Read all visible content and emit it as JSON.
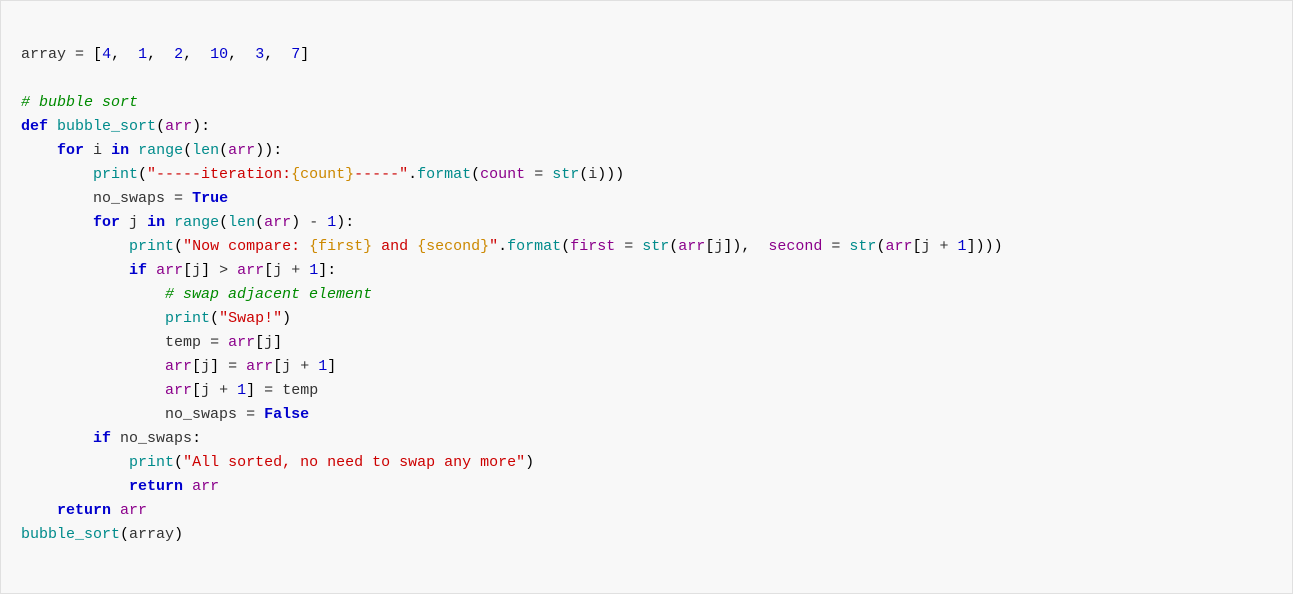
{
  "code": {
    "lines": [
      "array = [4,  1,  2,  10,  3,  7]",
      "",
      "# bubble sort",
      "def bubble_sort(arr):",
      "    for i in range(len(arr)):",
      "        print(\"-----iteration:{count}-----\".format(count = str(i)))",
      "        no_swaps = True",
      "        for j in range(len(arr) - 1):",
      "            print(\"Now compare: {first} and {second}\".format(first = str(arr[j]),  second = str(arr[j + 1])))",
      "            if arr[j] > arr[j + 1]:",
      "                # swap adjacent element",
      "                print(\"Swap!\")",
      "                temp = arr[j]",
      "                arr[j] = arr[j + 1]",
      "                arr[j + 1] = temp",
      "                no_swaps = False",
      "        if no_swaps:",
      "            print(\"All sorted, no need to swap any more\")",
      "            return arr",
      "    return arr",
      "bubble_sort(array)"
    ]
  }
}
